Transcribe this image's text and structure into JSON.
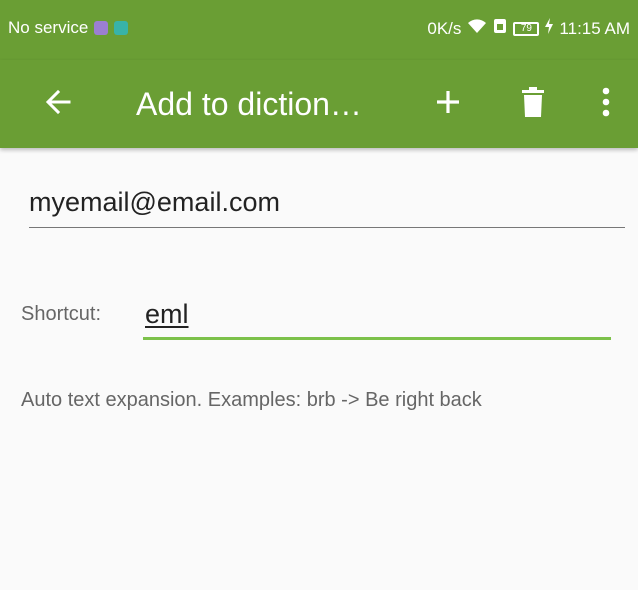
{
  "status_bar": {
    "carrier": "No service",
    "net_speed": "0K/s",
    "battery_level": "79",
    "time": "11:15 AM"
  },
  "app_bar": {
    "title": "Add to diction…",
    "background": "#6a9e34",
    "icons": [
      "back-arrow-icon",
      "plus-icon",
      "trash-icon",
      "more-vert-icon"
    ]
  },
  "form": {
    "word_value": "myemail@email.com",
    "shortcut_label": "Shortcut:",
    "shortcut_value": "eml",
    "accent": "#7cc14a",
    "hint": "Auto text expansion. Examples: brb -> Be right back"
  }
}
